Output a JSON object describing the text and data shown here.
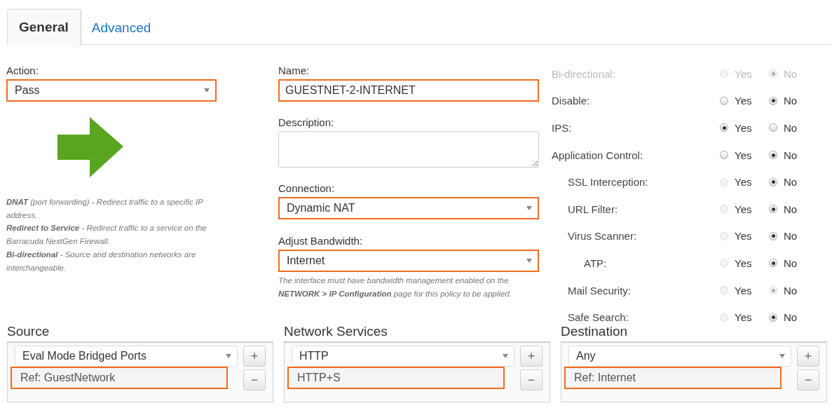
{
  "tabs": [
    {
      "label": "General",
      "selected": true
    },
    {
      "label": "Advanced",
      "selected": false
    }
  ],
  "action": {
    "label": "Action:",
    "value": "Pass",
    "highlighted": true
  },
  "action_help": [
    "**DNAT** (port forwarding) - Redirect traffic to a specific IP address.",
    "**Redirect to Service** - Redirect traffic to a service on the Barracuda NextGen Firewall.",
    "**Bi-directional** - Source and destination networks are interchangeable."
  ],
  "name": {
    "label": "Name:",
    "value": "GUESTNET-2-INTERNET",
    "highlighted": true
  },
  "description": {
    "label": "Description:"
  },
  "connection": {
    "label": "Connection:",
    "value": "Dynamic NAT",
    "highlighted": true
  },
  "bandwidth": {
    "label": "Adjust Bandwidth:",
    "value": "Internet",
    "highlighted": true,
    "note": "The interface must have bandwidth management enabled on the **NETWORK > IP Configuration** page for this policy to be applied."
  },
  "options": [
    {
      "label": "Bi-directional:",
      "disabled": true,
      "choices": [
        {
          "label": "Yes",
          "selected": false,
          "disabled": true
        },
        {
          "label": "No",
          "selected": true,
          "disabled": true
        }
      ]
    },
    {
      "label": "Disable:",
      "disabled": false,
      "choices": [
        {
          "label": "Yes",
          "selected": false,
          "disabled": false
        },
        {
          "label": "No",
          "selected": true,
          "disabled": false
        }
      ]
    },
    {
      "label": "IPS:",
      "disabled": false,
      "choices": [
        {
          "label": "Yes",
          "selected": true,
          "disabled": false
        },
        {
          "label": "No",
          "selected": false,
          "disabled": false
        }
      ]
    },
    {
      "label": "Application Control:",
      "disabled": false,
      "choices": [
        {
          "label": "Yes",
          "selected": false,
          "disabled": false
        },
        {
          "label": "No",
          "selected": true,
          "disabled": false
        }
      ],
      "children": [
        {
          "label": "SSL Interception:",
          "disabled": false,
          "choices": [
            {
              "label": "Yes",
              "selected": false,
              "disabled": true
            },
            {
              "label": "No",
              "selected": true,
              "disabled": false
            }
          ]
        },
        {
          "label": "URL Filter:",
          "disabled": false,
          "choices": [
            {
              "label": "Yes",
              "selected": false,
              "disabled": true
            },
            {
              "label": "No",
              "selected": true,
              "disabled": false
            }
          ]
        },
        {
          "label": "Virus Scanner:",
          "disabled": false,
          "choices": [
            {
              "label": "Yes",
              "selected": false,
              "disabled": true
            },
            {
              "label": "No",
              "selected": true,
              "disabled": false
            }
          ],
          "children": [
            {
              "label": "ATP:",
              "disabled": false,
              "choices": [
                {
                  "label": "Yes",
                  "selected": false,
                  "disabled": true
                },
                {
                  "label": "No",
                  "selected": true,
                  "disabled": false
                }
              ]
            }
          ]
        },
        {
          "label": "Mail Security:",
          "disabled": false,
          "choices": [
            {
              "label": "Yes",
              "selected": false,
              "disabled": true
            },
            {
              "label": "No",
              "selected": true,
              "disabled": true
            }
          ]
        },
        {
          "label": "Safe Search:",
          "disabled": false,
          "choices": [
            {
              "label": "Yes",
              "selected": false,
              "disabled": true
            },
            {
              "label": "No",
              "selected": true,
              "disabled": false
            }
          ]
        }
      ]
    }
  ],
  "sections": [
    {
      "title": "Source",
      "select": "Eval Mode Bridged Ports",
      "items": [
        {
          "label": "Ref: GuestNetwork",
          "highlighted": true
        }
      ],
      "add": "+",
      "remove": "−"
    },
    {
      "title": "Network Services",
      "select": "HTTP",
      "items": [
        {
          "label": "HTTP+S",
          "highlighted": true
        }
      ],
      "add": "+",
      "remove": "−"
    },
    {
      "title": "Destination",
      "select": "Any",
      "items": [
        {
          "label": "Ref: Internet",
          "highlighted": true
        }
      ],
      "add": "+",
      "remove": "−"
    }
  ]
}
